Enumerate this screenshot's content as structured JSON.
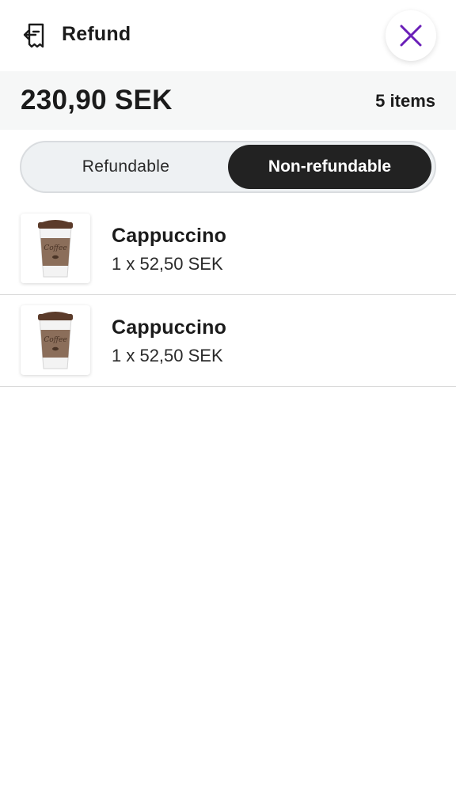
{
  "header": {
    "title": "Refund",
    "refund_icon": "receipt-return-icon",
    "close_icon": "close-icon"
  },
  "summary": {
    "total": "230,90 SEK",
    "item_count": "5 items"
  },
  "tabs": {
    "refundable": "Refundable",
    "non_refundable": "Non-refundable",
    "selected": "non_refundable"
  },
  "items": [
    {
      "name": "Cappuccino",
      "price": "1 x 52,50 SEK",
      "cup_text": "Coffee"
    },
    {
      "name": "Cappuccino",
      "price": "1 x 52,50 SEK",
      "cup_text": "Coffee"
    }
  ],
  "colors": {
    "accent": "#6a1fb8",
    "selected_tab_bg": "#222222",
    "summary_bg": "#f6f7f7",
    "cup_sleeve": "#8b6e5a",
    "cup_lid": "#5b3b2a"
  }
}
